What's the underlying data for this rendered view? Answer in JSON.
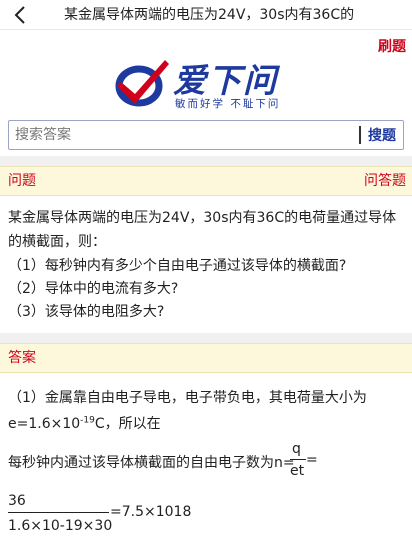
{
  "header": {
    "title": "某金属导体两端的电压为24V，30s内有36C的"
  },
  "toolbar": {
    "brush_label": "刷题"
  },
  "logo": {
    "title": "爱下问",
    "slogan": "敏而好学  不耻下问"
  },
  "search": {
    "placeholder": "搜索答案",
    "button_label": "搜题"
  },
  "question_bar": {
    "left": "问题",
    "right": "问答题"
  },
  "question": {
    "stem": "某金属导体两端的电压为24V，30s内有36C的电荷量通过导体的横截面，则：",
    "items": [
      "（1）每秒钟内有多少个自由电子通过该导体的横截面?",
      "（2）导体中的电流有多大?",
      "（3）该导体的电阻多大?"
    ]
  },
  "answer_bar": {
    "left": "答案"
  },
  "answer": {
    "line1": "（1）金属靠自由电子导电，电子带负电，其电荷量大小为",
    "line2_base": "e=1.6×10",
    "line2_exp": "-19",
    "line2_tail": "C，所以在",
    "line3": "每秒钟内通过该导体横截面的自由电子数为n=",
    "frac1_num": "q",
    "frac1_den": "et",
    "frac1_eq": "=",
    "frac2_num": "36",
    "frac2_den": "1.6×10-19×30",
    "frac2_result": "=7.5×1018"
  },
  "colors": {
    "accent_red": "#d0021b",
    "brand_blue": "#1f3a9e",
    "bar_bg": "#fdf8dc"
  }
}
